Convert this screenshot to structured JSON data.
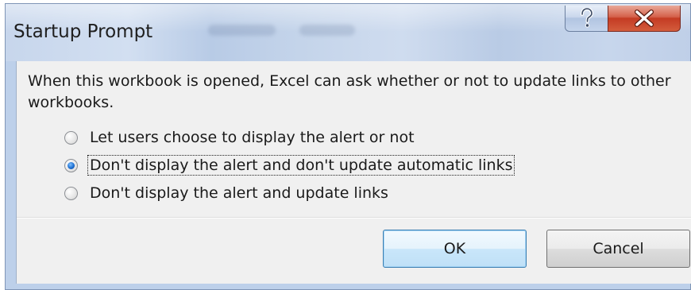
{
  "dialog": {
    "title": "Startup Prompt",
    "help_icon": "question-mark-icon",
    "close_icon": "close-x-icon"
  },
  "message": "When this workbook is opened, Excel can ask whether or not to update links to other workbooks.",
  "options": [
    {
      "label": "Let users choose to display the alert or not",
      "checked": false
    },
    {
      "label": "Don't display the alert and don't update automatic links",
      "checked": true
    },
    {
      "label": "Don't display the alert and update links",
      "checked": false
    }
  ],
  "buttons": {
    "ok_label": "OK",
    "cancel_label": "Cancel"
  },
  "colors": {
    "close_button": "#c43b23",
    "default_button_border": "#3c7fb1",
    "radio_selected": "#1d6fd1"
  }
}
